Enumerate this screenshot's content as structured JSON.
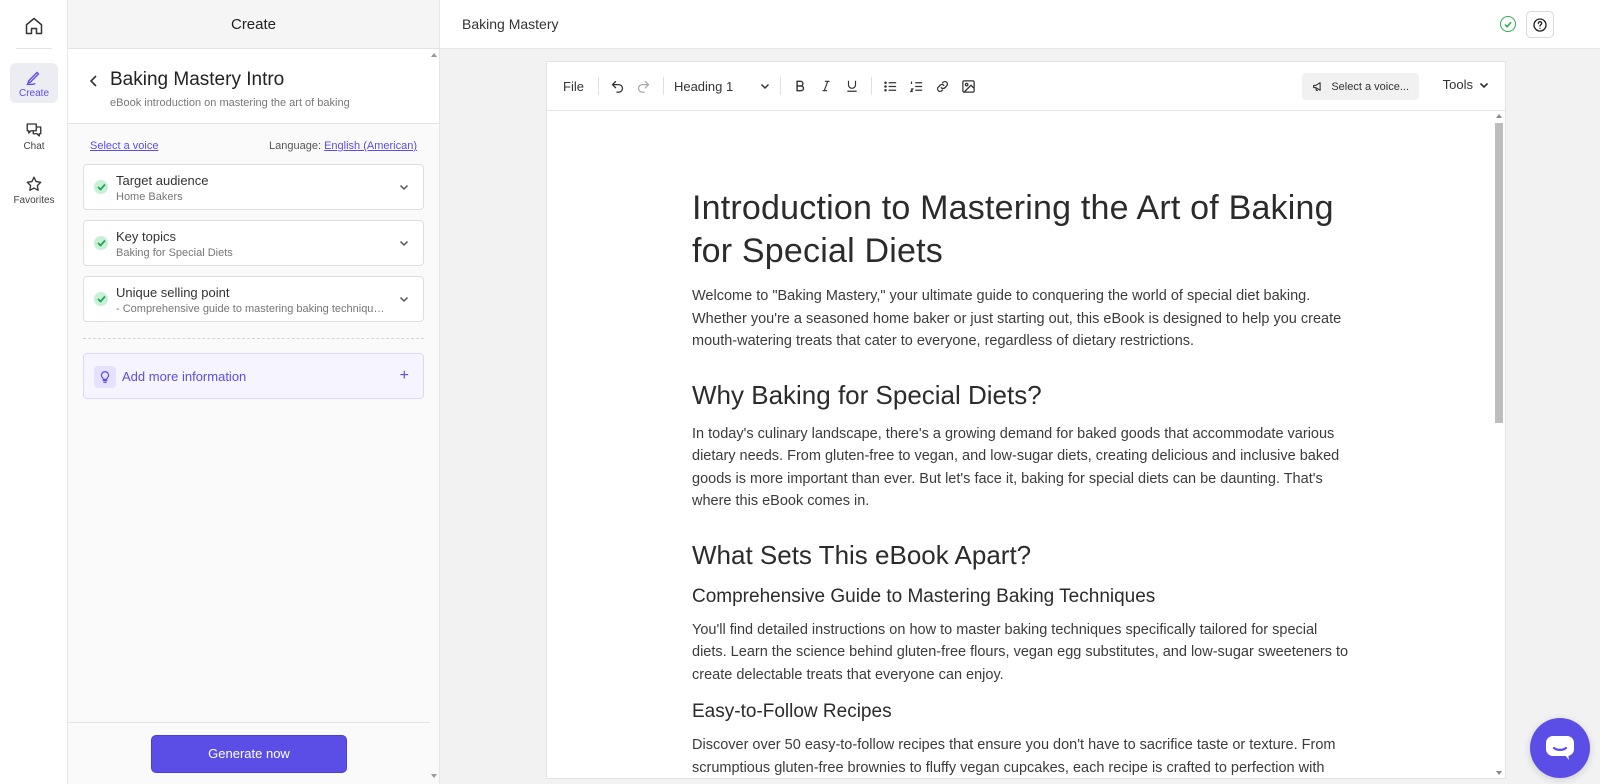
{
  "rail": {
    "items": [
      {
        "label": "Create",
        "icon": "pen-icon",
        "active": true
      },
      {
        "label": "Chat",
        "icon": "chat-icon",
        "active": false
      },
      {
        "label": "Favorites",
        "icon": "star-icon",
        "active": false
      }
    ]
  },
  "panel": {
    "header": "Create",
    "doc_title": "Baking Mastery Intro",
    "doc_subtitle": "eBook introduction on mastering the art of baking",
    "select_voice": "Select a voice",
    "language_label": "Language:",
    "language_value": "English (American)",
    "fields": [
      {
        "label": "Target audience",
        "value": "Home Bakers"
      },
      {
        "label": "Key topics",
        "value": "Baking for Special Diets"
      },
      {
        "label": "Unique selling point",
        "value": "- Comprehensive guide to mastering baking techniques specifically tailored for special diets"
      }
    ],
    "add_more": "Add more information",
    "generate": "Generate now"
  },
  "topbar": {
    "title": "Baking Mastery"
  },
  "toolbar": {
    "file": "File",
    "heading": "Heading 1",
    "voice": "Select a voice...",
    "tools": "Tools"
  },
  "document": {
    "h1": "Introduction to Mastering the Art of Baking for Special Diets",
    "p1": "Welcome to \"Baking Mastery,\" your ultimate guide to conquering the world of special diet baking. Whether you're a seasoned home baker or just starting out, this eBook is designed to help you create mouth-watering treats that cater to everyone, regardless of dietary restrictions.",
    "h2a": "Why Baking for Special Diets?",
    "p2": "In today's culinary landscape, there's a growing demand for baked goods that accommodate various dietary needs. From gluten-free to vegan, and low-sugar diets, creating delicious and inclusive baked goods is more important than ever. But let's face it, baking for special diets can be daunting. That's where this eBook comes in.",
    "h2b": "What Sets This eBook Apart?",
    "h3a": "Comprehensive Guide to Mastering Baking Techniques",
    "p3": "You'll find detailed instructions on how to master baking techniques specifically tailored for special diets. Learn the science behind gluten-free flours, vegan egg substitutes, and low-sugar sweeteners to create delectable treats that everyone can enjoy.",
    "h3b": "Easy-to-Follow Recipes",
    "p4": "Discover over 50 easy-to-follow recipes that ensure you don't have to sacrifice taste or texture. From scrumptious gluten-free brownies to fluffy vegan cupcakes, each recipe is crafted to perfection with"
  },
  "colors": {
    "accent": "#5b4ee6",
    "success": "#2eaa5a"
  }
}
